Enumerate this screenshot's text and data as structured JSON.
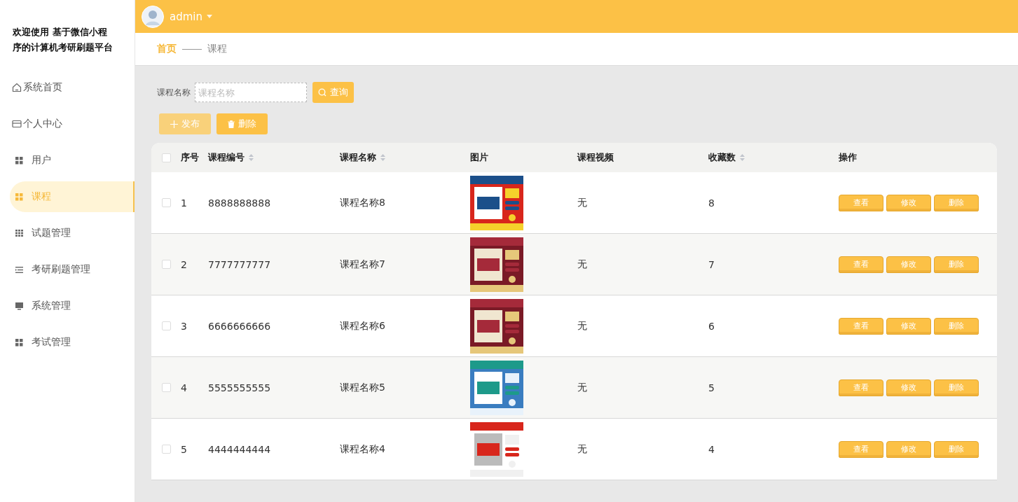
{
  "sidebar": {
    "title": "欢迎使用 基于微信小程序的计算机考研刷题平台",
    "items": [
      {
        "label": "系统首页",
        "selected": false
      },
      {
        "label": "个人中心",
        "selected": false
      },
      {
        "label": "用户",
        "selected": false
      },
      {
        "label": "课程",
        "selected": true
      },
      {
        "label": "试题管理",
        "selected": false
      },
      {
        "label": "考研刷题管理",
        "selected": false
      },
      {
        "label": "系统管理",
        "selected": false
      },
      {
        "label": "考试管理",
        "selected": false
      }
    ]
  },
  "topbar": {
    "user": "admin"
  },
  "breadcrumb": [
    "首页",
    "课程"
  ],
  "search": {
    "label": "课程名称",
    "placeholder": "课程名称",
    "button": "查询"
  },
  "actions": [
    {
      "label": "发布",
      "kind": "add",
      "disabled": true
    },
    {
      "label": "删除",
      "kind": "delete",
      "disabled": false
    }
  ],
  "table": {
    "select_all_checked": false,
    "columns": [
      {
        "label": "序号",
        "sortable": false
      },
      {
        "label": "课程编号",
        "sortable": true
      },
      {
        "label": "课程名称",
        "sortable": true
      },
      {
        "label": "图片",
        "sortable": false
      },
      {
        "label": "课程视频",
        "sortable": false
      },
      {
        "label": "收藏数",
        "sortable": true
      },
      {
        "label": "操作",
        "sortable": false
      }
    ],
    "rows": [
      {
        "index": "1",
        "code": "8888888888",
        "name": "课程名称8",
        "video": "无",
        "favorites": "8",
        "checked": false,
        "buttons": [
          "查看",
          "修改",
          "删除"
        ]
      },
      {
        "index": "2",
        "code": "7777777777",
        "name": "课程名称7",
        "video": "无",
        "favorites": "7",
        "checked": false,
        "buttons": [
          "查看",
          "修改",
          "删除"
        ]
      },
      {
        "index": "3",
        "code": "6666666666",
        "name": "课程名称6",
        "video": "无",
        "favorites": "6",
        "checked": false,
        "buttons": [
          "查看",
          "修改",
          "删除"
        ]
      },
      {
        "index": "4",
        "code": "5555555555",
        "name": "课程名称5",
        "video": "无",
        "favorites": "5",
        "checked": false,
        "buttons": [
          "查看",
          "修改",
          "删除"
        ]
      },
      {
        "index": "5",
        "code": "4444444444",
        "name": "课程名称4",
        "video": "无",
        "favorites": "4",
        "checked": false,
        "buttons": [
          "查看",
          "修改",
          "删除"
        ]
      }
    ]
  }
}
